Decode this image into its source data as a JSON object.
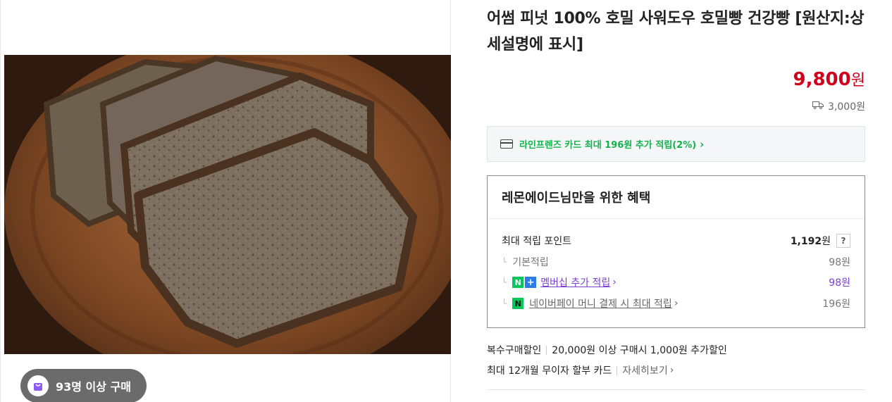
{
  "product": {
    "title": "어썸 피넛 100% 호밀 사워도우 호밀빵 건강빵 [원산지:상세설명에 표시]",
    "price": "9,800",
    "price_unit": "원",
    "shipping_fee": "3,000원",
    "buyers_badge": "93명 이상 구매"
  },
  "card_banner": {
    "text": "라인프렌즈 카드 최대 196원 추가 적립(2%)",
    "chevron": "›"
  },
  "benefits": {
    "title": "레몬에이드님만을 위한 혜택",
    "max_points_label": "최대 적립 포인트",
    "max_points_value": "1,192",
    "max_points_unit": "원",
    "help": "?",
    "basic_label": "기본적립",
    "basic_value": "98원",
    "membership_label": "멤버십 추가 적립",
    "membership_value": "98원",
    "npay_label": "네이버페이 머니 결제 시 최대 적립",
    "npay_value": "196원",
    "n_mark": "N",
    "plus_mark": "+"
  },
  "extras": {
    "multi_label": "복수구매할인",
    "multi_text": "20,000원 이상 구매시 1,000원 추가할인",
    "installment_text": "최대 12개월 무이자 할부 카드",
    "details_link": "자세히보기"
  },
  "colors": {
    "price": "#d2001a",
    "card_green": "#12b34a",
    "membership_purple": "#7a3fd1"
  },
  "icons": [
    "shopping-bag-icon",
    "truck-icon",
    "card-icon",
    "chevron-right-icon",
    "naver-n-icon",
    "plus-icon",
    "help-icon"
  ]
}
